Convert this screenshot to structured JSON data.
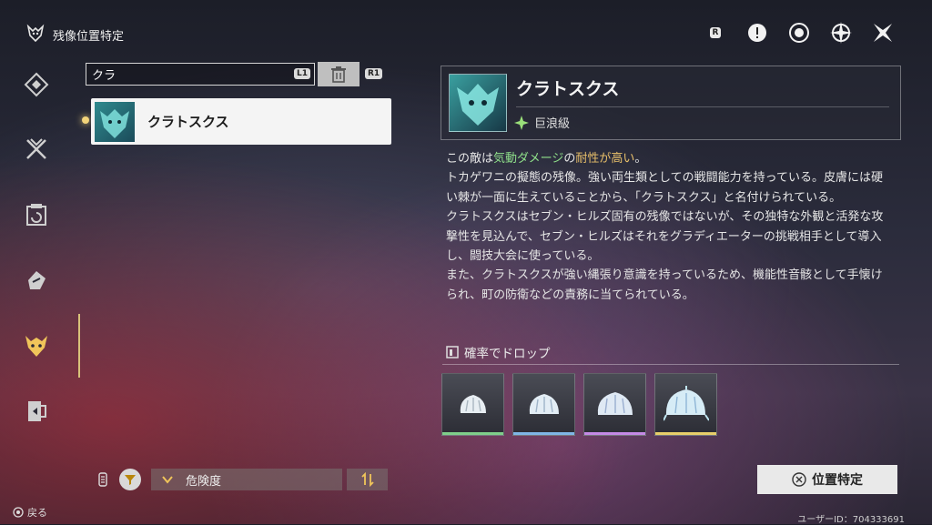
{
  "header": {
    "title": "残像位置特定"
  },
  "top_icons": [
    "r-key-icon",
    "alert-icon",
    "target-icon",
    "compass-icon",
    "close-star-icon"
  ],
  "rail": {
    "items": [
      "diamond-icon",
      "crossed-swords-icon",
      "calendar-icon",
      "hand-icon",
      "demon-icon",
      "door-icon"
    ],
    "active_index": 4
  },
  "search": {
    "value": "クラ",
    "key_hint": "L1",
    "r1_hint": "R1"
  },
  "results": [
    {
      "name": "クラトスクス"
    }
  ],
  "detail": {
    "name": "クラトスクス",
    "rank": "巨浪級",
    "desc_lead": "この敵は",
    "desc_hl1": "気動ダメージ",
    "desc_mid": "の",
    "desc_hl2": "耐性が高い",
    "desc_end": "。",
    "desc_para1": "トカゲワニの擬態の残像。強い両生類としての戦闘能力を持っている。皮膚には硬い棘が一面に生えていることから、「クラトスクス」と名付けられている。",
    "desc_para2": "クラトスクスはセブン・ヒルズ固有の残像ではないが、その独特な外観と活発な攻撃性を見込んで、セブン・ヒルズはそれをグラディエーターの挑戦相手として導入し、闘技大会に使っている。",
    "desc_para3": "また、クラトスクスが強い縄張り意識を持っているため、機能性音骸として手懐けられ、町の防衛などの責務に当てられている。"
  },
  "drops": {
    "heading": "確率でドロップ",
    "items": [
      {
        "color": "#7fcf8a"
      },
      {
        "color": "#7fb6e6"
      },
      {
        "color": "#c58ae6"
      },
      {
        "color": "#e8cf6a"
      }
    ]
  },
  "bottom": {
    "sort_label": "危険度",
    "locate_label": "位置特定",
    "back_label": "戻る",
    "uid": "ユーザーID：704333691"
  }
}
